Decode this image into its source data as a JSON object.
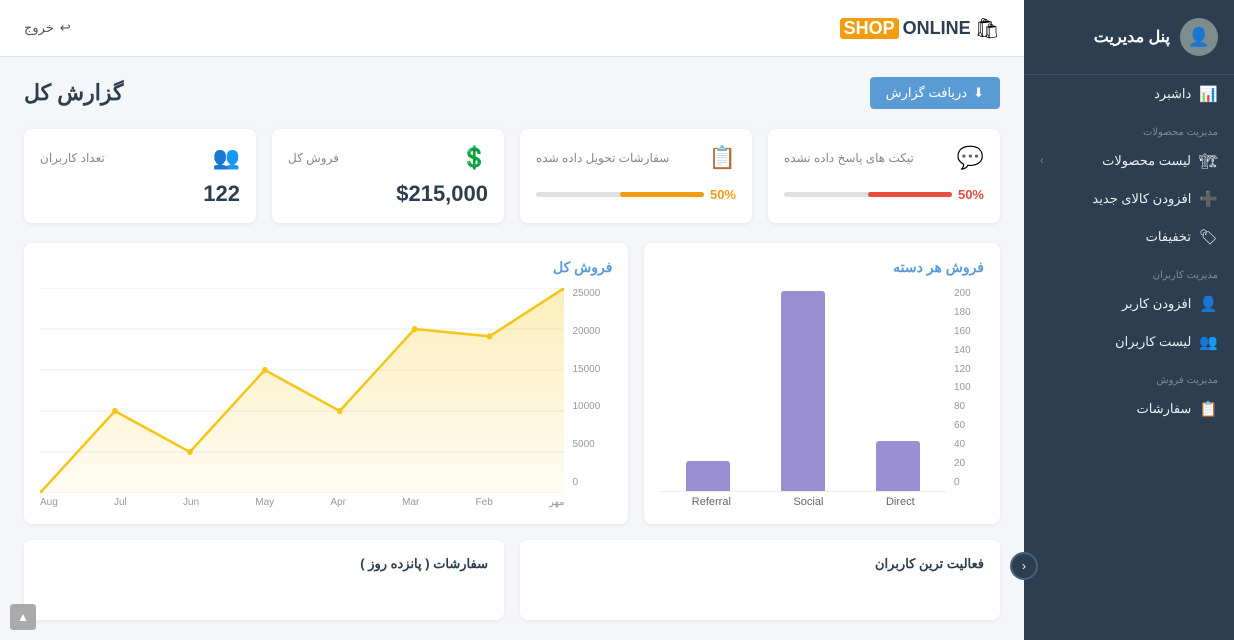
{
  "sidebar": {
    "title": "پنل مدیریت",
    "sections": [
      {
        "label": "",
        "items": [
          {
            "id": "dashboard",
            "label": "داشبرد",
            "icon": "📊",
            "chevron": false
          }
        ]
      },
      {
        "label": "مدیریت محصولات",
        "items": [
          {
            "id": "product-list",
            "label": "لیست محصولات",
            "icon": "🏗",
            "chevron": true
          },
          {
            "id": "add-product",
            "label": "افزودن کالای جدید",
            "icon": "➕",
            "chevron": false
          },
          {
            "id": "discounts",
            "label": "تخفیفات",
            "icon": "🏷",
            "chevron": false
          }
        ]
      },
      {
        "label": "مدیریت کاربران",
        "items": [
          {
            "id": "add-user",
            "label": "افزودن کاربر",
            "icon": "👤",
            "chevron": false
          },
          {
            "id": "user-list",
            "label": "لیست کاربران",
            "icon": "👥",
            "chevron": false
          }
        ]
      },
      {
        "label": "مدیریت فروش",
        "items": [
          {
            "id": "orders",
            "label": "سفارشات",
            "icon": "📋",
            "chevron": false
          }
        ]
      }
    ]
  },
  "topbar": {
    "logo_online": "ONLINE",
    "logo_shop": "SHOP",
    "exit_label": "خروج"
  },
  "page": {
    "title": "گزارش کل",
    "btn_report": "دریافت گزارش"
  },
  "stats": [
    {
      "id": "unanswered-tickets",
      "label": "تیکت های پاسخ داده نشده",
      "value": "",
      "pct": "50%",
      "bar_color": "#e74c3c",
      "icon": "💬"
    },
    {
      "id": "delivered-orders",
      "label": "سفارشات تحویل داده شده",
      "value": "",
      "pct": "50%",
      "bar_color": "#f39c12",
      "icon": "📋"
    },
    {
      "id": "total-sales",
      "label": "فروش کل",
      "value": "$215,000",
      "pct": "",
      "bar_color": "",
      "icon": "$"
    },
    {
      "id": "users-count",
      "label": "تعداد کاربران",
      "value": "122",
      "pct": "",
      "bar_color": "",
      "icon": "👥"
    }
  ],
  "bar_chart": {
    "title": "فروش هر دسته",
    "y_labels": [
      "200",
      "180",
      "160",
      "140",
      "120",
      "100",
      "80",
      "60",
      "40",
      "20",
      "0"
    ],
    "bars": [
      {
        "label": "Direct",
        "value": 50,
        "max": 200
      },
      {
        "label": "Social",
        "value": 200,
        "max": 200
      },
      {
        "label": "Referral",
        "value": 30,
        "max": 200
      }
    ]
  },
  "line_chart": {
    "title": "فروش کل",
    "x_labels": [
      "مهر",
      "Feb",
      "Mar",
      "Apr",
      "May",
      "Jun",
      "Jul",
      "Aug"
    ],
    "y_labels": [
      "25000",
      "20000",
      "15000",
      "10000",
      "5000",
      "0"
    ],
    "data_points": [
      200,
      10000,
      5000,
      15000,
      10000,
      20000,
      19000,
      25000
    ]
  },
  "bottom": {
    "left_title": "سفارشات ( پانزده روز )",
    "right_title": "فعالیت ترین کاربران"
  }
}
